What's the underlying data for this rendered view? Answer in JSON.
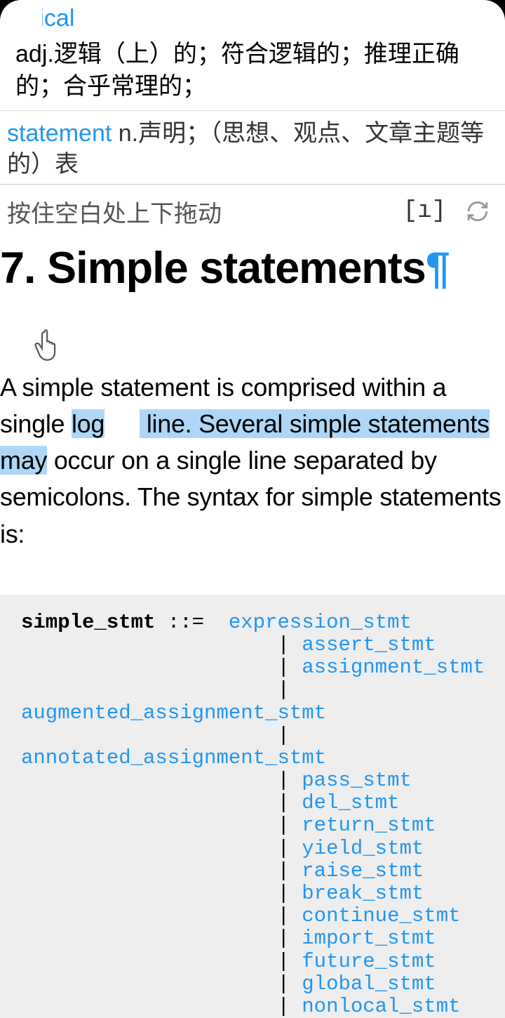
{
  "dict1": {
    "word": "logical",
    "definition": "adj.逻辑（上）的；符合逻辑的；推理正确的；合乎常理的；"
  },
  "dict2": {
    "word": "statement",
    "definition": " n.声明；（思想、观点、文章主题等的）表"
  },
  "hint": {
    "text": "按住空白处上下拖动",
    "bracket": "[ı]"
  },
  "heading": "7. Simple statements",
  "pilcrow": "¶",
  "paragraph": {
    "p1": "A simple statement is comprised within a single ",
    "hl1": "log",
    "mid_posthand": "",
    "hl2": " line. Several simple statements may",
    "p2": " occur on a single line separated by semicolons. The syntax for simple statements is:"
  },
  "code": {
    "lhs": "simple_stmt",
    "op": " ::=  ",
    "items": [
      "expression_stmt",
      "assert_stmt",
      "assignment_stmt"
    ],
    "wrap1": "augmented_assignment_stmt",
    "wrap2": "annotated_assignment_stmt",
    "items2": [
      "pass_stmt",
      "del_stmt",
      "return_stmt",
      "yield_stmt",
      "raise_stmt",
      "break_stmt",
      "continue_stmt",
      "import_stmt",
      "future_stmt",
      "global_stmt",
      "nonlocal_stmt"
    ]
  }
}
